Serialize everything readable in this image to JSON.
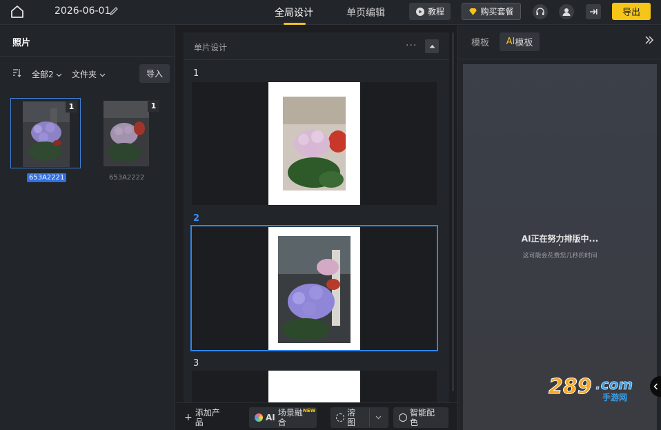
{
  "topbar": {
    "date": "2026-06-01",
    "tabs": {
      "global": "全局设计",
      "page": "单页编辑"
    },
    "tutorial_label": "教程",
    "buy_label": "购买套餐",
    "export_label": "导出"
  },
  "left_panel": {
    "title": "照片",
    "filter_all": "全部2",
    "filter_folder": "文件夹",
    "import_label": "导入",
    "photos": [
      {
        "name": "653A2221",
        "count": "1",
        "selected": true
      },
      {
        "name": "653A2222",
        "count": "1",
        "selected": false
      }
    ]
  },
  "center": {
    "title": "单片设计",
    "more": "···",
    "pages": [
      {
        "num": "1"
      },
      {
        "num": "2",
        "selected": true
      },
      {
        "num": "3"
      }
    ],
    "bottom": {
      "add_product": "添加产品",
      "ai_prefix": "AI",
      "ai_blend": "场景融合",
      "new_tag": "NEW",
      "cutout": "溶图",
      "smart_color": "智能配色"
    }
  },
  "right_panel": {
    "tab_template": "模板",
    "tab_ai_prefix": "AI",
    "tab_ai_suffix": "模板",
    "status_main": "AI正在努力排版中...",
    "status_sub": "这可能会花费您几秒的时间"
  },
  "watermark": {
    "text_main": "289",
    "text_com": ".com",
    "text_sub": "手游网"
  },
  "colors": {
    "accent_yellow": "#f5c518",
    "select_blue": "#2f86ee",
    "bg": "#1c1e22",
    "panel": "#22252a"
  }
}
